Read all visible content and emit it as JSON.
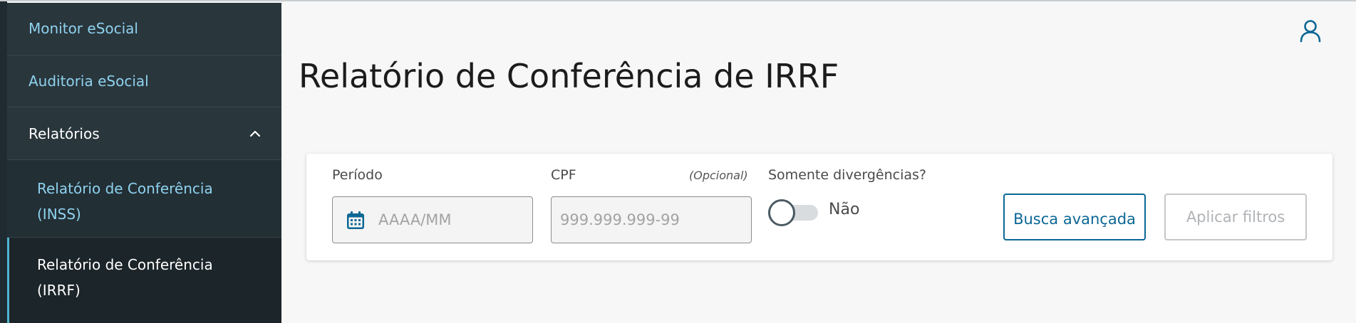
{
  "sidebar": {
    "items": [
      {
        "label": "Monitor eSocial"
      },
      {
        "label": "Auditoria eSocial"
      },
      {
        "label": "Relatórios"
      }
    ],
    "subitems": [
      {
        "label": "Relatório de Conferência (INSS)"
      },
      {
        "label": "Relatório de Conferência (IRRF)"
      }
    ]
  },
  "page": {
    "title": "Relatório de Conferência de IRRF"
  },
  "filters": {
    "periodo": {
      "label": "Período",
      "placeholder": "AAAA/MM"
    },
    "cpf": {
      "label": "CPF",
      "optional": "(Opcional)",
      "placeholder": "999.999.999-99"
    },
    "divergencias": {
      "label": "Somente divergências?",
      "state_text": "Não"
    },
    "busca_label": "Busca avançada",
    "aplicar_label": "Aplicar filtros"
  },
  "icons": {
    "user": "user-icon",
    "calendar": "calendar-icon",
    "chevron": "chevron-up-icon"
  },
  "colors": {
    "sidebar_bg": "#29363c",
    "link": "#8fd2ee",
    "primary": "#0c6795",
    "active_indicator": "#4fb5d0"
  }
}
